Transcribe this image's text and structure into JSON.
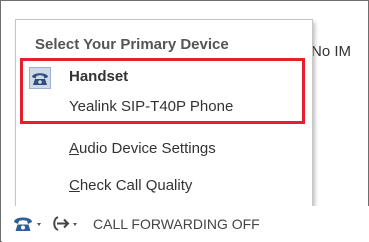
{
  "background": {
    "status_text": "No IM"
  },
  "menu": {
    "header": "Select Your Primary Device",
    "primary_device": {
      "icon": "handset-icon",
      "label": "Handset",
      "device_name": "Yealink SIP-T40P Phone"
    },
    "items": [
      {
        "label": "Audio Device Settings"
      },
      {
        "label": "Check Call Quality"
      }
    ]
  },
  "bottom_bar": {
    "phone_button_icon": "phone-icon",
    "forwarding_button_icon": "call-forwarding-icon",
    "forwarding_status": "CALL FORWARDING OFF"
  },
  "colors": {
    "highlight_border": "#e61e2d",
    "icon_blue": "#2f5f9a",
    "text": "#333333"
  }
}
